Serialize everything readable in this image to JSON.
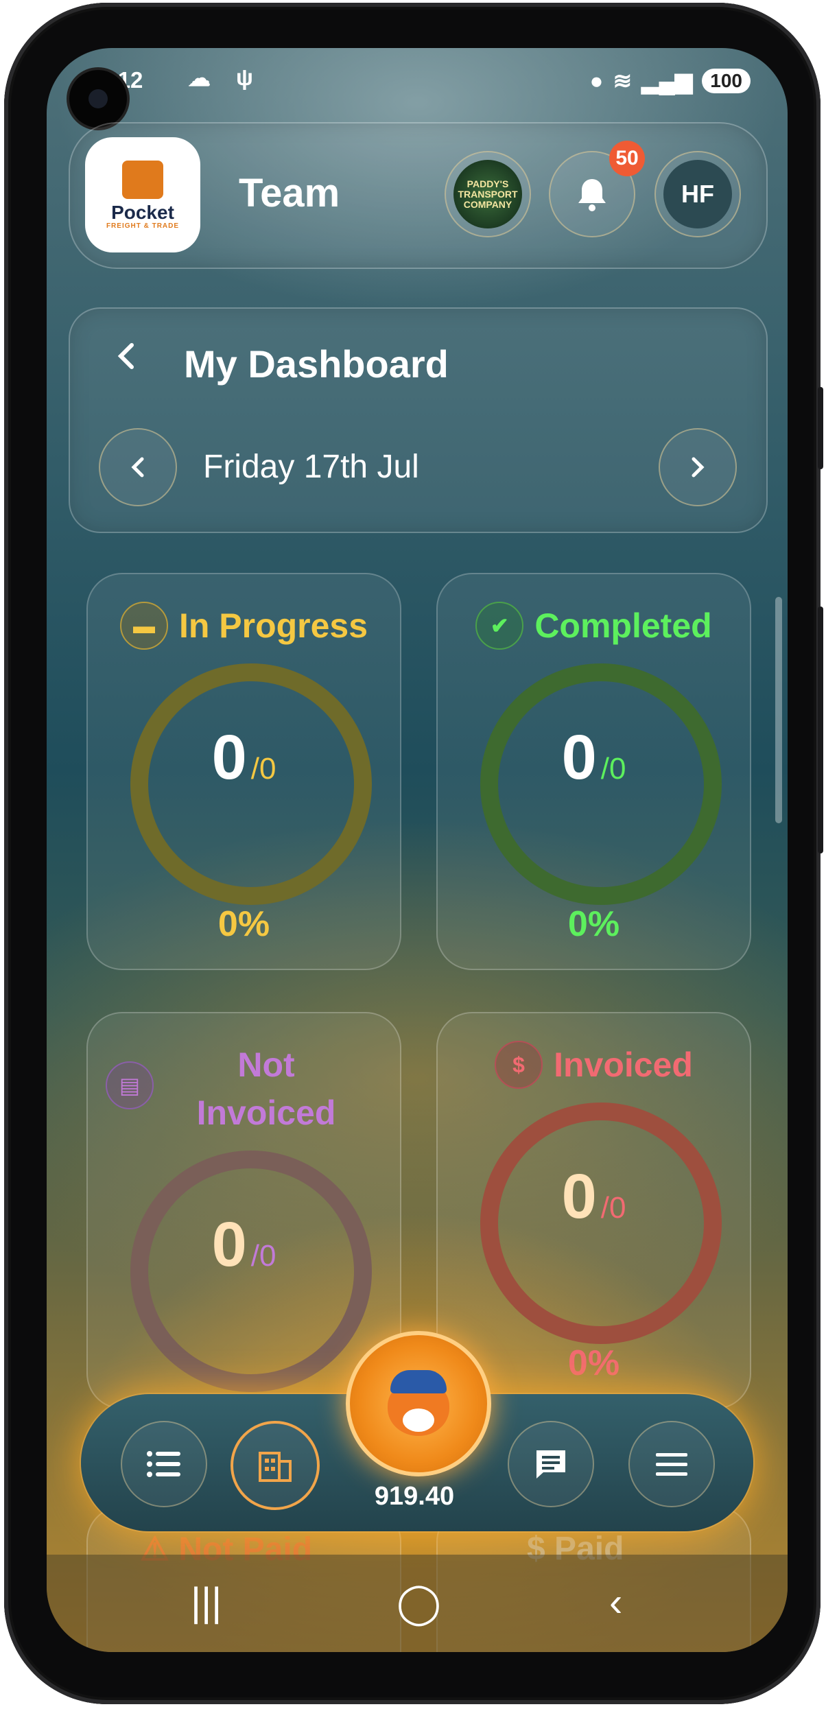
{
  "status_bar": {
    "time": "21:12",
    "battery": "100"
  },
  "header": {
    "logo_brand": "Pocket",
    "logo_sub": "FREIGHT & TRADE",
    "title": "Team",
    "company_badge_text": "PADDY'S TRANSPORT COMPANY",
    "notification_count": "50",
    "avatar_initials": "HF"
  },
  "dashboard": {
    "title": "My Dashboard",
    "date": "Friday 17th Jul"
  },
  "cards": [
    {
      "label": "In Progress",
      "value": "0",
      "total": "/0",
      "percent": "0%",
      "color": "#f5c842",
      "ring": "#6f6b2a"
    },
    {
      "label": "Completed",
      "value": "0",
      "total": "/0",
      "percent": "0%",
      "color": "#5df05d",
      "ring": "#3e6a2f"
    },
    {
      "label_line1": "Not",
      "label_line2": "Invoiced",
      "value": "0",
      "total": "/0",
      "color": "#c27ad8",
      "ring": "#7a5f58"
    },
    {
      "label": "Invoiced",
      "value": "0",
      "total": "/0",
      "percent": "0%",
      "color": "#f26a72",
      "ring": "#9e4f3e"
    }
  ],
  "peek": {
    "not_paid": "Not Paid",
    "paid": "Paid"
  },
  "bottom_nav": {
    "balance": "919.40"
  },
  "icons": [
    "cloud-icon",
    "usb-icon",
    "location-icon",
    "wifi-icon",
    "signal-icon",
    "bell-icon",
    "chevron-left-icon",
    "chevron-right-icon",
    "truck-icon",
    "check-circle-icon",
    "invoice-icon",
    "dollar-icon",
    "warning-icon",
    "list-icon",
    "building-icon",
    "chat-icon",
    "menu-icon"
  ]
}
